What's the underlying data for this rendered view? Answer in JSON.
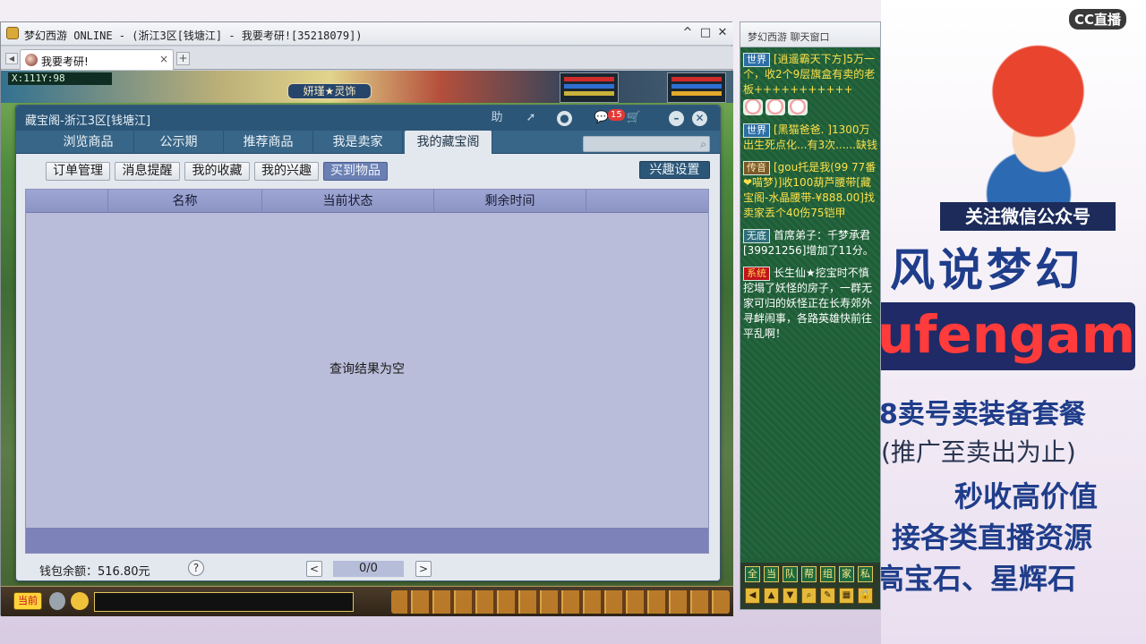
{
  "window": {
    "title": "梦幻西游 ONLINE - (浙江3区[钱塘江] - 我要考研![35218079])",
    "min": "^",
    "restore": "□",
    "close": "✕",
    "tab_label": "我要考研!",
    "tab_close": "×",
    "tab_add": "+",
    "tab_arrow": "◀"
  },
  "game": {
    "coords": "X:111Y:98",
    "name_tag": "妍瑾★灵饰",
    "channel_button": "当前"
  },
  "dialog": {
    "title": "藏宝阁-浙江3区[钱塘江]",
    "help_btn": "助",
    "mail_count": "15",
    "nav_tabs": [
      "浏览商品",
      "公示期",
      "推荐商品",
      "我是卖家",
      "我的藏宝阁"
    ],
    "active_tab": "我的藏宝阁",
    "sub_buttons": [
      "订单管理",
      "消息提醒",
      "我的收藏",
      "我的兴趣",
      "买到物品"
    ],
    "active_sub": "买到物品",
    "interest_settings": "兴趣设置",
    "search_placeholder": "",
    "columns": [
      "名称",
      "当前状态",
      "剩余时间"
    ],
    "empty_message": "查询结果为空",
    "wallet_label": "钱包余额：516.80元",
    "help_mark": "?",
    "prev": "<",
    "next": ">",
    "page_text": "0/0"
  },
  "chat": {
    "title": "梦幻西游 聊天窗口",
    "messages": [
      {
        "tag": "世界",
        "kind": "world",
        "text": "[逍遥霸天下方]5万一个，收2个9层旗盒有卖的老板+++++++++++"
      },
      {
        "tag": "世界",
        "kind": "world",
        "text": "[黑猫爸爸. ]1300万出生死点化...有3次......缺钱"
      },
      {
        "tag": "传音",
        "kind": "rumor",
        "text": "[gou托是我(99 77番❤喵梦)]收100葫芦腰带[藏宝阁-水晶腰带-¥888.00]找卖家丢个40伤75铠甲"
      },
      {
        "tag": "无底",
        "kind": "none",
        "text": "首席弟子：千梦承君[39921256]增加了11分。"
      },
      {
        "tag": "系统",
        "kind": "sys",
        "text": "长生仙★挖宝时不慎挖塌了妖怪的房子，一群无家可归的妖怪正在长寿郊外寻衅闹事，各路英雄快前往平乱啊！"
      }
    ],
    "channels": [
      "全",
      "当",
      "队",
      "帮",
      "组",
      "家",
      "私"
    ]
  },
  "promo": {
    "cc_logo": "CC直播",
    "follow": "关注微信公众号",
    "brand": "风说梦幻",
    "wechat_id": "ufengamh",
    "line1": "8卖号卖装备套餐",
    "line2": "(推广至卖出为止)",
    "line3": "秒收高价值",
    "line4": "接各类直播资源",
    "line5": "高宝石、星辉石"
  },
  "colors": {
    "dialog_header": "#2c5677",
    "table_body": "#babdd9",
    "chat_bg": "#215f3a"
  }
}
